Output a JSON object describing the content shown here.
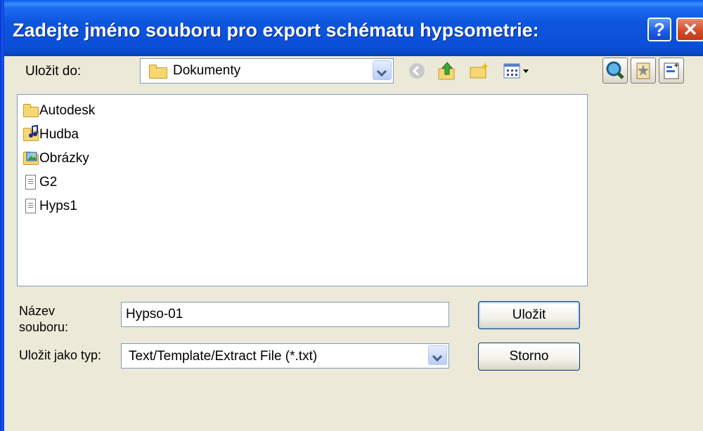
{
  "window": {
    "title": "Zadejte jméno souboru pro export schématu hypsometrie:"
  },
  "titlebar_buttons": {
    "help": "?",
    "close": "✕"
  },
  "save_in": {
    "label": "Uložit do:",
    "value": "Dokumenty"
  },
  "toolbar_icons": [
    "back-icon",
    "up-folder-icon",
    "new-folder-icon",
    "view-menu-icon"
  ],
  "side_icons": [
    "search-icon",
    "favorites-icon",
    "tools-icon"
  ],
  "files": [
    {
      "name": "Autodesk",
      "icon": "folder-icon"
    },
    {
      "name": "Hudba",
      "icon": "music-folder-icon"
    },
    {
      "name": "Obrázky",
      "icon": "pictures-folder-icon"
    },
    {
      "name": "G2",
      "icon": "text-file-icon"
    },
    {
      "name": "Hyps1",
      "icon": "text-file-icon"
    }
  ],
  "filename": {
    "label": "Název souboru:",
    "value": "Hypso-01"
  },
  "filetype": {
    "label": "Uložit jako typ:",
    "value": "Text/Template/Extract File (*.txt)"
  },
  "buttons": {
    "save": "Uložit",
    "cancel": "Storno"
  },
  "colors": {
    "titlebar": "#0a4fd6",
    "dialog_bg": "#ece9d8",
    "field_border": "#7f9db9"
  }
}
